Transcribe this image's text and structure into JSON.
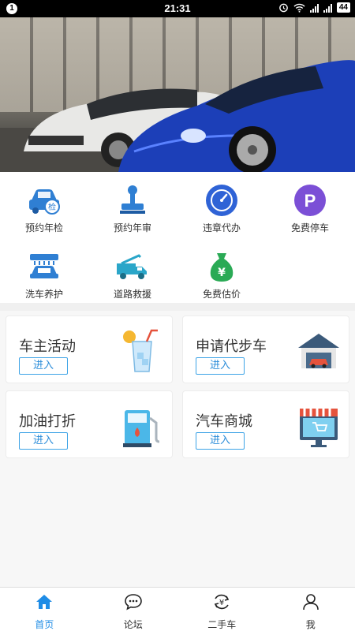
{
  "status_bar": {
    "notification_count": "1",
    "time": "21:31",
    "battery": "44"
  },
  "banner": {
    "image": "car-showroom-banner"
  },
  "grid_menu": {
    "items": [
      {
        "label": "预约年检",
        "icon": "car-inspection-icon"
      },
      {
        "label": "预约年审",
        "icon": "stamp-icon"
      },
      {
        "label": "违章代办",
        "icon": "speedometer-icon"
      },
      {
        "label": "免费停车",
        "icon": "parking-icon"
      },
      {
        "label": "洗车养护",
        "icon": "car-wash-icon"
      },
      {
        "label": "道路救援",
        "icon": "tow-truck-icon"
      },
      {
        "label": "免费估价",
        "icon": "money-bag-icon"
      }
    ]
  },
  "cards": [
    {
      "title": "车主活动",
      "button": "进入",
      "icon": "drink-icon"
    },
    {
      "title": "申请代步车",
      "button": "进入",
      "icon": "garage-icon"
    },
    {
      "title": "加油打折",
      "button": "进入",
      "icon": "fuel-pump-icon"
    },
    {
      "title": "汽车商城",
      "button": "进入",
      "icon": "online-store-icon"
    }
  ],
  "bottom_nav": [
    {
      "label": "首页",
      "icon": "home-icon",
      "active": true
    },
    {
      "label": "论坛",
      "icon": "chat-icon",
      "active": false
    },
    {
      "label": "二手车",
      "icon": "yuan-exchange-icon",
      "active": false
    },
    {
      "label": "我",
      "icon": "user-icon",
      "active": false
    }
  ],
  "colors": {
    "accent": "#1e8ce6",
    "icon_blue": "#2f7fd3",
    "icon_purple": "#7b4fd6",
    "icon_green": "#2aaa55"
  }
}
